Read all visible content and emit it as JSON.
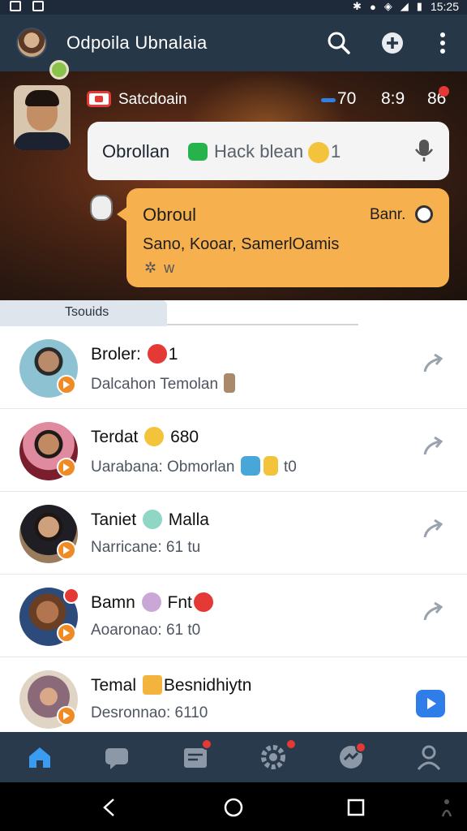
{
  "status_bar": {
    "time": "15:25"
  },
  "app_bar": {
    "title": "Odpoila Ubnalaia",
    "icons": [
      "avatar-icon",
      "search-icon",
      "add-icon",
      "more-vert-icon"
    ]
  },
  "hero": {
    "user_name": "Satcdoain",
    "stats": [
      "70",
      "8:9",
      "86"
    ],
    "bubble_white": {
      "title": "Obrollan",
      "text": "Hack blean",
      "count": "1"
    },
    "bubble_orange": {
      "title": "Obroul",
      "right_label": "Banr.",
      "subtitle": "Sano, Kooar, SamerlOamis"
    }
  },
  "tabs": {
    "active_label": "Tsouids"
  },
  "chats": [
    {
      "name": "Broler:",
      "name_suffix": "1",
      "preview": "Dalcahon Temolan",
      "avatar_colors": [
        "#7fb8c9",
        "#3e6f55"
      ]
    },
    {
      "name": "Terdat",
      "name_suffix": "680",
      "preview": "Uarabana: Obmorlan",
      "preview_suffix": "t0",
      "avatar_colors": [
        "#d8839a",
        "#7a1e2e"
      ]
    },
    {
      "name": "Taniet",
      "name_suffix": "Malla",
      "preview": "Narricane: 61 tu",
      "avatar_colors": [
        "#9a7b5c",
        "#1e1e24"
      ]
    },
    {
      "name": "Bamn",
      "name_suffix": "Fnt",
      "preview": "Aoaronao: 61 t0",
      "avatar_colors": [
        "#2c4b7a",
        "#6a3e22"
      ]
    },
    {
      "name": "Temal",
      "name_suffix": "Besnidhiytn",
      "preview": "Desronnao: 6110",
      "avatar_colors": [
        "#e0d4c4",
        "#8a6a78"
      ]
    }
  ],
  "bottom_nav": [
    "home-icon",
    "chat-icon",
    "inbox-icon",
    "settings-icon",
    "messenger-icon",
    "profile-icon"
  ],
  "colors": {
    "appbar": "#263748",
    "accent_orange": "#f6b04e",
    "accent_blue": "#2f7de8",
    "badge_red": "#e53935"
  }
}
